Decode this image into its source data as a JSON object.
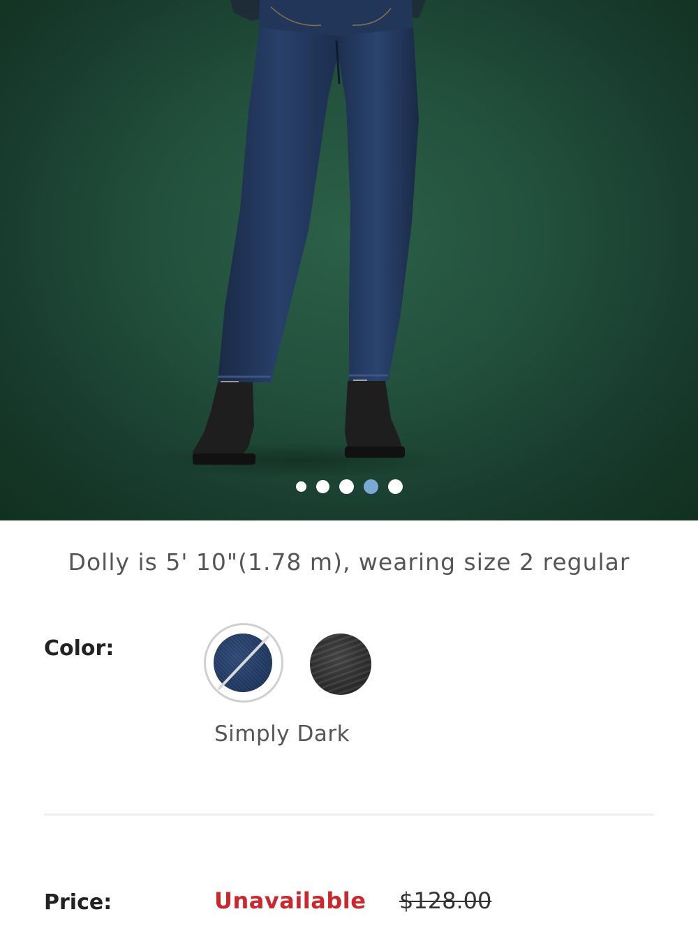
{
  "product_image": {
    "alt_icon": "product-photo",
    "carousel": {
      "total": 5,
      "active_index": 3
    },
    "colors": {
      "background": "#22503c",
      "dot": "#ffffff",
      "dot_active": "#7aa9d4"
    }
  },
  "model_caption": "Dolly is 5' 10\"(1.78 m), wearing size 2 regular",
  "color_section": {
    "label": "Color:",
    "selected_name": "Simply Dark",
    "swatches": [
      {
        "icon": "denim-swatch",
        "selected": true,
        "unavailable": true,
        "color": "#213a64"
      },
      {
        "icon": "black-swatch",
        "selected": false,
        "unavailable": false,
        "color": "#333333"
      }
    ]
  },
  "price_section": {
    "label": "Price:",
    "status": "Unavailable",
    "original_price": "$128.00",
    "status_color": "#c8282e"
  }
}
